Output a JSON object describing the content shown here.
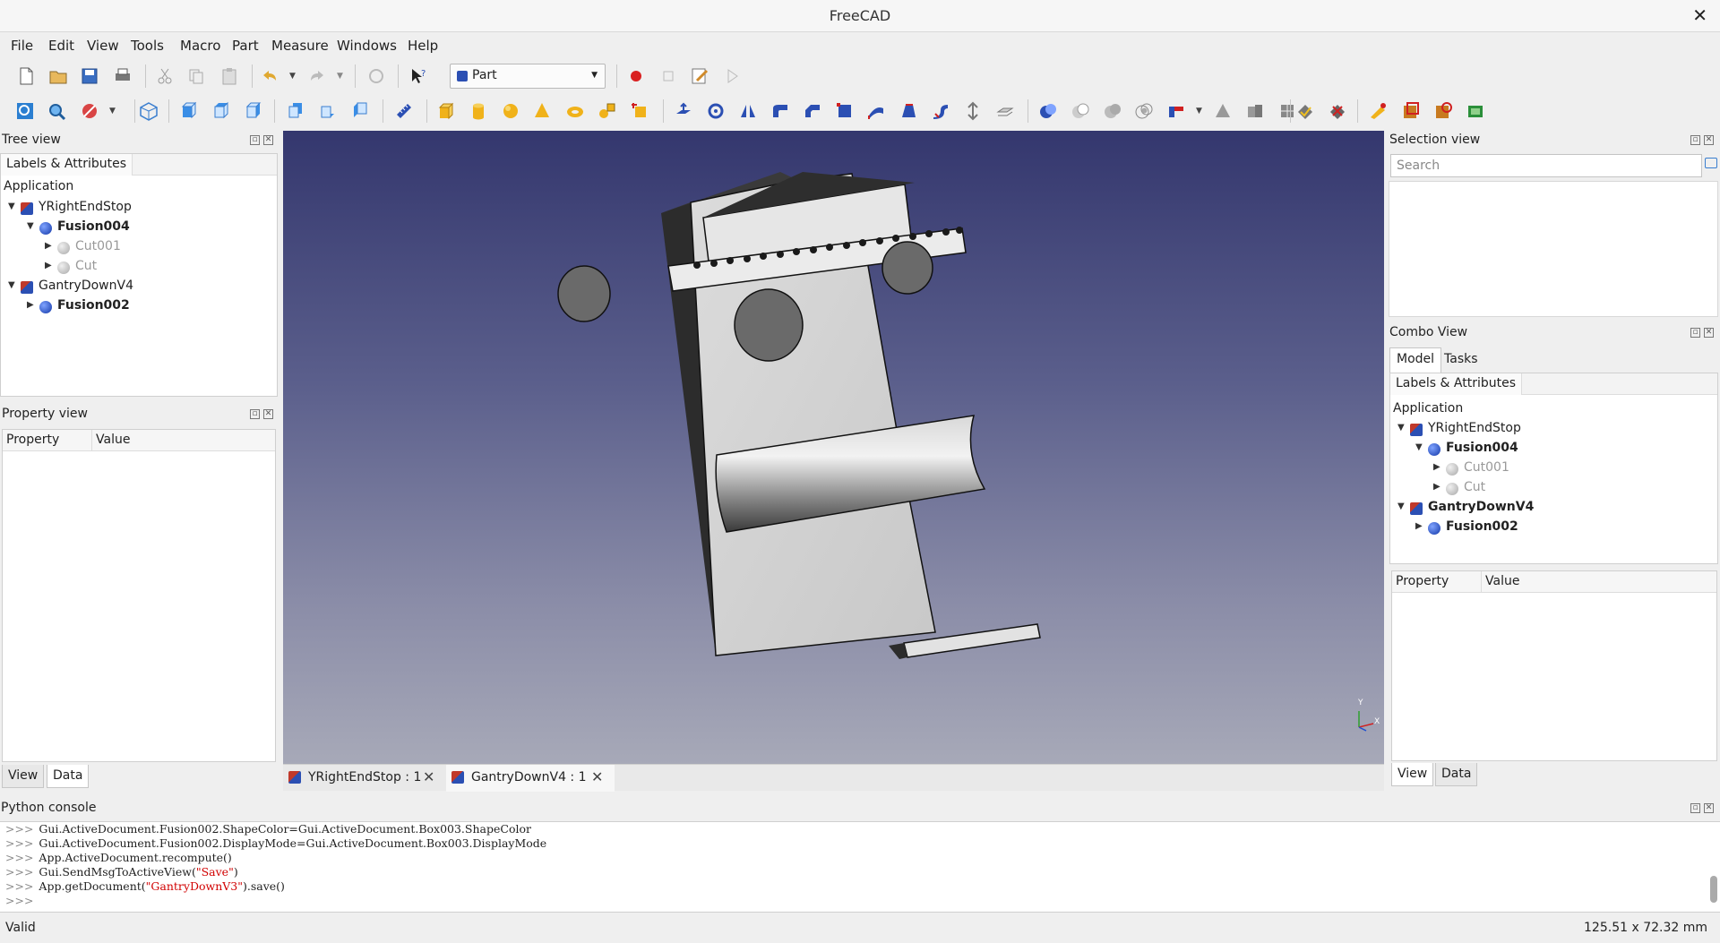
{
  "window": {
    "title": "FreeCAD"
  },
  "menu": [
    "File",
    "Edit",
    "View",
    "Tools",
    "Macro",
    "Part",
    "Measure",
    "Windows",
    "Help"
  ],
  "toolbar": {
    "workbench": "Part"
  },
  "tree_view": {
    "title": "Tree view",
    "tab": "Labels & Attributes",
    "root": "Application",
    "items": [
      {
        "label": "YRightEndStop",
        "icon": "document-icon",
        "expanded": true
      },
      {
        "label": "Fusion004",
        "icon": "fusion-icon",
        "expanded": true
      },
      {
        "label": "Cut001",
        "icon": "cut-icon",
        "expanded": false
      },
      {
        "label": "Cut",
        "icon": "cut-icon",
        "expanded": false
      },
      {
        "label": "GantryDownV4",
        "icon": "document-icon",
        "expanded": true
      },
      {
        "label": "Fusion002",
        "icon": "fusion-icon",
        "expanded": false
      }
    ]
  },
  "property_view": {
    "title": "Property view",
    "col_property": "Property",
    "col_value": "Value",
    "tab_view": "View",
    "tab_data": "Data"
  },
  "selection_view": {
    "title": "Selection view",
    "search_placeholder": "Search"
  },
  "combo_view": {
    "title": "Combo View",
    "tab_model": "Model",
    "tab_tasks": "Tasks",
    "tree_tab": "Labels & Attributes",
    "root": "Application",
    "items": [
      {
        "label": "YRightEndStop"
      },
      {
        "label": "Fusion004"
      },
      {
        "label": "Cut001"
      },
      {
        "label": "Cut"
      },
      {
        "label": "GantryDownV4"
      },
      {
        "label": "Fusion002"
      }
    ],
    "col_property": "Property",
    "col_value": "Value",
    "tab_view": "View",
    "tab_data": "Data"
  },
  "document_tabs": [
    {
      "label": "YRightEndStop : 1"
    },
    {
      "label": "GantryDownV4 : 1"
    }
  ],
  "axis": {
    "y": "Y",
    "x": "X"
  },
  "python_console": {
    "title": "Python console",
    "prompt": ">>>",
    "lines": [
      "Gui.ActiveDocument.Fusion002.ShapeColor=Gui.ActiveDocument.Box003.ShapeColor",
      "Gui.ActiveDocument.Fusion002.DisplayMode=Gui.ActiveDocument.Box003.DisplayMode",
      "App.ActiveDocument.recompute()",
      "Gui.SendMsgToActiveView(",
      "App.getDocument(",
      ""
    ],
    "line4_str": "\"Save\"",
    "line4_end": ")",
    "line5_str": "\"GantryDownV3\"",
    "line5_end": ").save()"
  },
  "status": {
    "left": "Valid",
    "right": "125.51 x 72.32 mm"
  }
}
